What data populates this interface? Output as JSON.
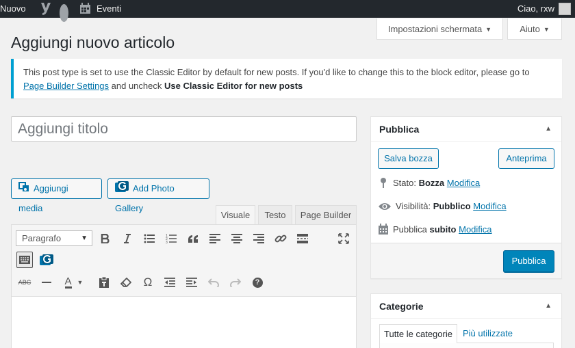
{
  "adminbar": {
    "new_label": "Nuovo",
    "events_label": "Eventi",
    "greeting": "Ciao, rxw"
  },
  "screen_options": {
    "label": "Impostazioni schermata",
    "caret": "▼"
  },
  "help": {
    "label": "Aiuto",
    "caret": "▼"
  },
  "page_title": "Aggiungi nuovo articolo",
  "notice": {
    "text_before": "This post type is set to use the Classic Editor by default for new posts. If you'd like to change this to the block editor, please go to ",
    "link": "Page Builder Settings",
    "text_mid": " and uncheck ",
    "bold": "Use Classic Editor for new posts",
    "accent_color": "#00a0d2"
  },
  "title_field": {
    "placeholder": "Aggiungi titolo"
  },
  "media_buttons": {
    "add_media": "Aggiungi media",
    "add_gallery": "Add Photo Gallery"
  },
  "editor_tabs": {
    "visual": "Visuale",
    "text": "Testo",
    "page_builder": "Page Builder",
    "active": "Visuale"
  },
  "toolbar": {
    "format_select": "Paragrafo",
    "row1": [
      "bold-icon",
      "italic-icon",
      "bullet-list-icon",
      "numbered-list-icon",
      "blockquote-icon",
      "align-left-icon",
      "align-center-icon",
      "align-right-icon",
      "link-icon",
      "read-more-icon",
      "fullscreen-icon"
    ],
    "row2": [
      "toolbar-toggle-icon",
      "gallery-plugin-icon"
    ],
    "row3": [
      "strikethrough-icon",
      "horizontal-line-icon",
      "text-color-icon",
      "paste-text-icon",
      "clear-formatting-icon",
      "special-character-icon",
      "outdent-icon",
      "indent-icon",
      "undo-icon",
      "redo-icon",
      "help-icon"
    ],
    "text_color_letter": "A",
    "omega": "Ω",
    "help": "?",
    "strike": "ABC"
  },
  "publish_box": {
    "title": "Pubblica",
    "save_draft": "Salva bozza",
    "preview": "Anteprima",
    "status_label": "Stato:",
    "status_value": "Bozza",
    "visibility_label": "Visibilità:",
    "visibility_value": "Pubblico",
    "publish_label": "Pubblica",
    "publish_value": "subito",
    "edit_link": "Modifica",
    "publish_button": "Pubblica",
    "toggle": "▲",
    "primary_color": "#0085ba"
  },
  "categories_box": {
    "title": "Categorie",
    "toggle": "▲",
    "tab_all": "Tutte le categorie",
    "tab_popular": "Più utilizzate"
  }
}
